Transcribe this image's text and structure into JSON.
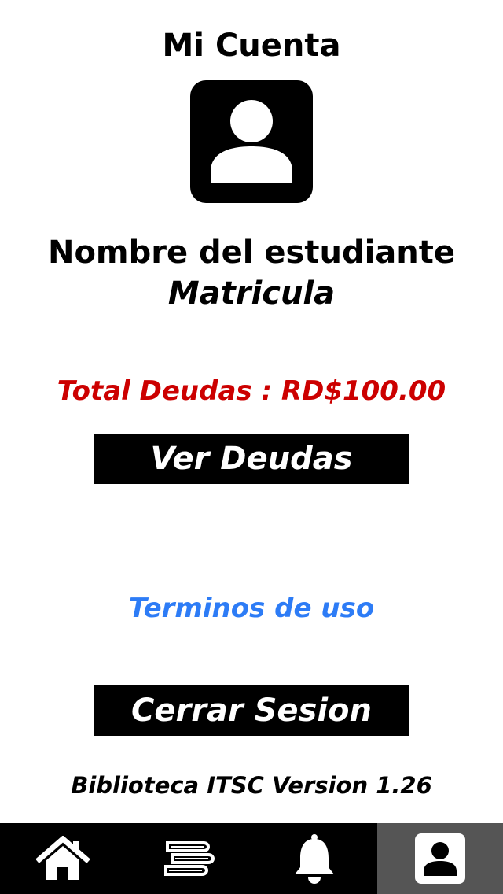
{
  "header": {
    "title": "Mi Cuenta"
  },
  "profile": {
    "avatar_icon": "person-icon",
    "student_name": "Nombre del estudiante",
    "matricula": "Matricula"
  },
  "debts": {
    "total_text": "Total Deudas : RD$100.00",
    "view_button_label": "Ver Deudas",
    "color": "#cc0000"
  },
  "links": {
    "terms_label": "Terminos de uso",
    "color": "#2d7cf6"
  },
  "session": {
    "logout_label": "Cerrar Sesion"
  },
  "footer": {
    "version_text": "Biblioteca ITSC Version 1.26"
  },
  "tabbar": {
    "items": [
      {
        "icon": "home-icon",
        "active": false
      },
      {
        "icon": "books-icon",
        "active": false
      },
      {
        "icon": "bell-icon",
        "active": false
      },
      {
        "icon": "person-icon",
        "active": true
      }
    ],
    "active_color": "#555555",
    "background": "#000000"
  }
}
